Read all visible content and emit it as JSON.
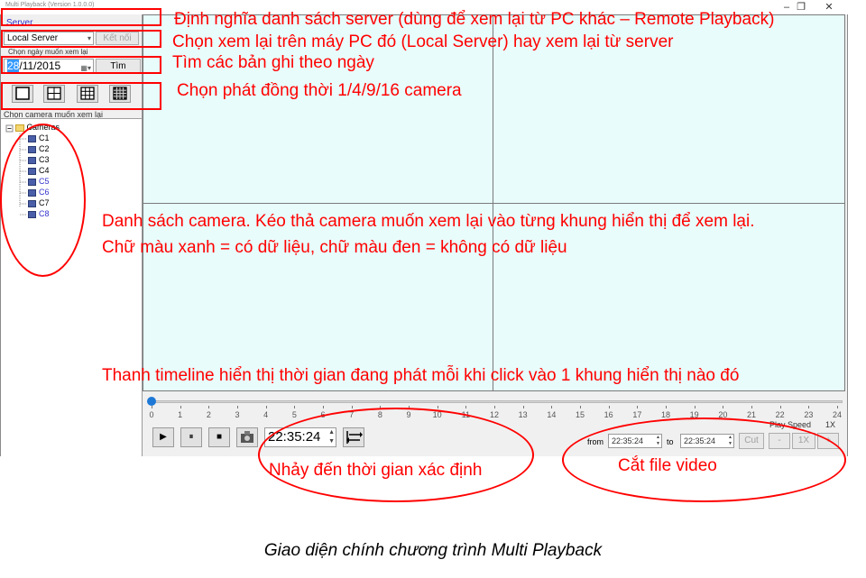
{
  "window": {
    "title": "Multi Playback (Version 1.0.0.0)",
    "min_glyph": "–",
    "restore_glyph": "❐",
    "close_glyph": "✕"
  },
  "sidebar": {
    "server_link": "Server",
    "server_select": "Local Server",
    "connect_button": "Kết nối",
    "date_label": "Chọn ngày muốn xem lại",
    "date_day": "28",
    "date_rest": "/11/2015",
    "find_button": "Tìm",
    "camera_label": "Chọn camera muốn xem lại",
    "tree_root": "Cameras",
    "cameras": [
      {
        "name": "C1",
        "color": "#000000"
      },
      {
        "name": "C2",
        "color": "#000000"
      },
      {
        "name": "C3",
        "color": "#000000"
      },
      {
        "name": "C4",
        "color": "#000000"
      },
      {
        "name": "C5",
        "color": "#3333cc"
      },
      {
        "name": "C6",
        "color": "#3333cc"
      },
      {
        "name": "C7",
        "color": "#000000"
      },
      {
        "name": "C8",
        "color": "#3333cc"
      }
    ]
  },
  "timeline": {
    "ticks": [
      "0",
      "1",
      "2",
      "3",
      "4",
      "5",
      "6",
      "7",
      "8",
      "9",
      "10",
      "11",
      "12",
      "13",
      "14",
      "15",
      "16",
      "17",
      "18",
      "19",
      "20",
      "21",
      "22",
      "23",
      "24"
    ],
    "position": 0
  },
  "controls": {
    "play_glyph": "▶",
    "pause_glyph": "⏸",
    "stop_glyph": "■",
    "goto_time": "22:35:24",
    "from_label": "from",
    "from_time": "22:35:24",
    "to_label": "to",
    "to_time": "22:35:24",
    "cut_button": "Cut",
    "play_speed_label": "Play Speed",
    "play_speed_value": "1X",
    "speed_minus": "-",
    "speed_value_button": "1X",
    "speed_plus": "+"
  },
  "annotations": {
    "server": "Định nghĩa danh sách server (dùng để xem lại từ PC khác – Remote Playback)",
    "local": "Chọn xem lại trên máy PC đó (Local Server) hay xem lại từ server",
    "search": "Tìm các bản ghi theo ngày",
    "layout": "Chọn phát đồng thời 1/4/9/16  camera",
    "camera_list_1": "Danh sách camera. Kéo thả camera muốn xem lại vào từng khung hiển thị để xem lại.",
    "camera_list_2": "Chữ màu xanh = có dữ liệu, chữ màu đen = không có dữ liệu",
    "timeline": "Thanh timeline hiển thị thời gian đang phát mỗi khi click vào 1 khung hiển thị nào đó",
    "jump": "Nhảy đến thời gian xác định",
    "cut": "Cắt file video"
  },
  "caption": "Giao diện chính chương trình Multi Playback",
  "colors": {
    "annotation": "#ff0000",
    "cell_bg": "#e8fcfc",
    "has_data": "#3333cc",
    "no_data": "#000000"
  }
}
